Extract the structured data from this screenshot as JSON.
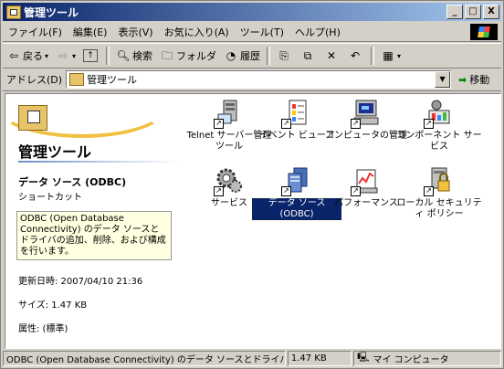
{
  "window": {
    "title": "管理ツール",
    "minimize": "_",
    "maximize": "□",
    "close": "X"
  },
  "menubar": {
    "items": [
      "ファイル(F)",
      "編集(E)",
      "表示(V)",
      "お気に入り(A)",
      "ツール(T)",
      "ヘルプ(H)"
    ]
  },
  "toolbar": {
    "back": "戻る",
    "search": "検索",
    "folders": "フォルダ",
    "history": "履歴"
  },
  "address": {
    "label": "アドレス(D)",
    "value": "管理ツール",
    "go": "移動"
  },
  "leftpane": {
    "title": "管理ツール",
    "selected_name": "データ ソース (ODBC)",
    "selected_type": "ショートカット",
    "description": "ODBC (Open Database Connectivity) のデータ ソースとドライバの追加、削除、および構成を行います。",
    "modified": "更新日時: 2007/04/10 21:36",
    "size": "サイズ: 1.47 KB",
    "attributes": "属性: (標準)"
  },
  "icons": [
    {
      "label": "Telnet サーバー管理ツール",
      "icon": "telnet-server-icon",
      "selected": false
    },
    {
      "label": "イベント ビューア",
      "icon": "event-viewer-icon",
      "selected": false
    },
    {
      "label": "コンピュータの管理",
      "icon": "computer-management-icon",
      "selected": false
    },
    {
      "label": "コンポーネント サービス",
      "icon": "component-services-icon",
      "selected": false
    },
    {
      "label": "サービス",
      "icon": "services-icon",
      "selected": false
    },
    {
      "label": "データ ソース (ODBC)",
      "icon": "odbc-data-source-icon",
      "selected": true
    },
    {
      "label": "パフォーマンス",
      "icon": "performance-icon",
      "selected": false
    },
    {
      "label": "ローカル セキュリティ ポリシー",
      "icon": "local-security-policy-icon",
      "selected": false
    }
  ],
  "status": {
    "text": "ODBC (Open Database Connectivity) のデータ ソースとドライバ",
    "size": "1.47 KB",
    "zone": "マイ コンピュータ"
  },
  "colors": {
    "titlebar": "#0a246a",
    "selection": "#0a246a",
    "infotip": "#ffffe1"
  }
}
